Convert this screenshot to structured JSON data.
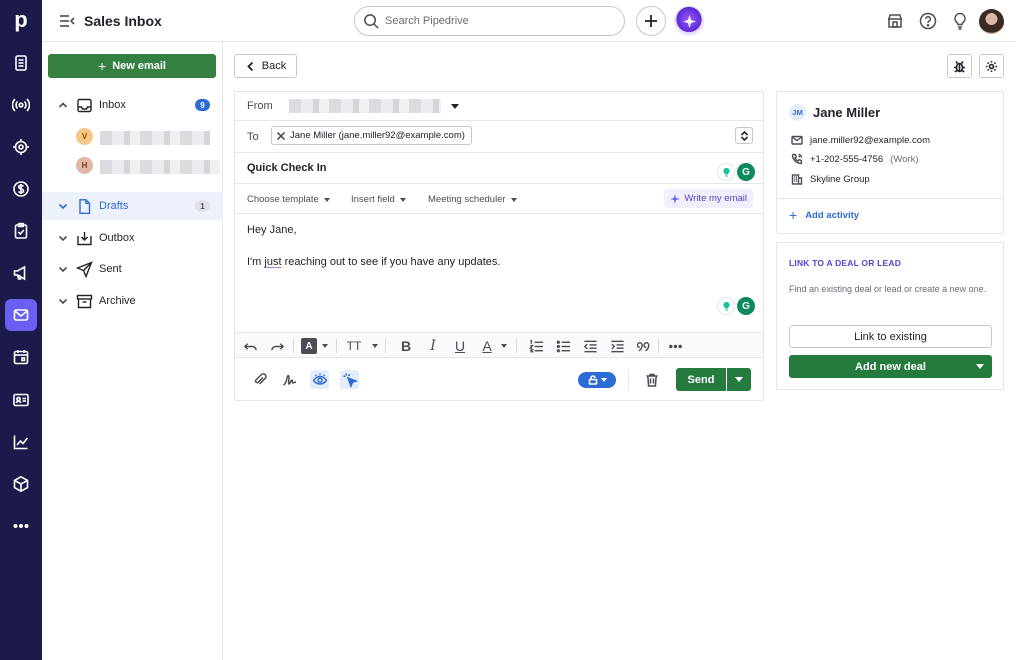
{
  "app": {
    "title": "Sales Inbox"
  },
  "search": {
    "placeholder": "Search Pipedrive"
  },
  "rail": {
    "logo": "p",
    "items": [
      "leads-icon",
      "broadcast-icon",
      "target-icon",
      "dollar-icon",
      "tasks-icon",
      "megaphone-icon",
      "mail-icon",
      "calendar-icon",
      "contacts-icon",
      "chart-icon",
      "product-icon",
      "more-icon"
    ],
    "active": "mail-icon"
  },
  "sidebar": {
    "new_email": "New email",
    "inbox": {
      "label": "Inbox",
      "count": "9"
    },
    "accounts": [
      {
        "initial": "V"
      },
      {
        "initial": "H"
      }
    ],
    "drafts": {
      "label": "Drafts",
      "count": "1"
    },
    "outbox": {
      "label": "Outbox"
    },
    "sent": {
      "label": "Sent"
    },
    "archive": {
      "label": "Archive"
    }
  },
  "composer": {
    "back": "Back",
    "from_label": "From",
    "to_label": "To",
    "to_recipient": "Jane Miller (jane.miller92@example.com)",
    "subject": "Quick Check In",
    "toolbar": {
      "choose_template": "Choose template",
      "insert_field": "Insert field",
      "meeting_scheduler": "Meeting scheduler",
      "write_my_email": "Write my email"
    },
    "body": {
      "greeting": "Hey Jane,",
      "line_pre": "I'm ",
      "line_underlined": "just",
      "line_post": " reaching out to see if you have any updates."
    },
    "send": "Send"
  },
  "person": {
    "initials": "JM",
    "name": "Jane Miller",
    "email": "jane.miller92@example.com",
    "phone": "+1-202-555-4756",
    "phone_type": "(Work)",
    "org": "Skyline Group",
    "add_activity": "Add activity"
  },
  "link_panel": {
    "title": "LINK TO A DEAL OR LEAD",
    "description": "Find an existing deal or lead or create a new one.",
    "link_existing": "Link to existing",
    "add_new_deal": "Add new deal"
  },
  "colors": {
    "rail": "#1c1a4b",
    "accent": "#6a5ff1",
    "primary_green": "#257a3e",
    "link_blue": "#2d6bd6"
  }
}
